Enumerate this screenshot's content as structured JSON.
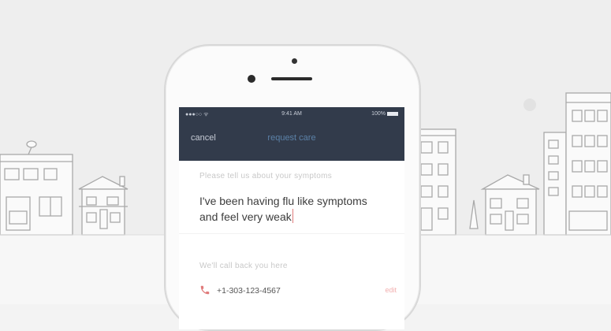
{
  "status_bar": {
    "signal": "●●●○○ ᯤ",
    "time": "9:41 AM",
    "battery": "100%"
  },
  "nav": {
    "cancel_label": "cancel",
    "title": "request care"
  },
  "form": {
    "symptoms_prompt": "Please tell us about your symptoms",
    "symptoms_value": "I've been having flu like symptoms and feel very weak",
    "contact_prompt": "We'll call back you here",
    "phone_number": "+1-303-123-4567",
    "edit_label": "edit"
  },
  "colors": {
    "nav_background": "#323b4b",
    "accent_blue": "#5c82a8",
    "accent_red": "#e07b7b"
  }
}
